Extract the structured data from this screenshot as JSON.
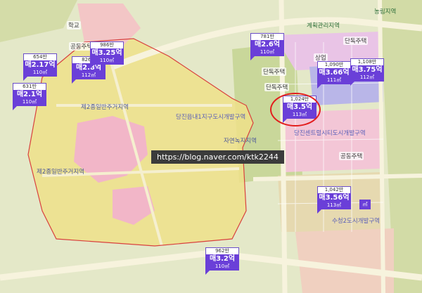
{
  "map": {
    "watermark": "https://blog.naver.com/ktk2244",
    "colors": {
      "residential_zone": "#eee08a",
      "boundary": "#d9413e",
      "road": "#f7f3dd",
      "green": "#cfd99c",
      "pin": "#6a3fd8",
      "highlight": "#e31d1d"
    },
    "labels": {
      "school": "학교",
      "apt_left": "공동주택",
      "zone_2_upper": "제2종일반주거지역",
      "zone_2_lower": "제2종일반주거지역",
      "dev_district": "당진읍내1지구도시개발구역",
      "natural_green": "자연녹지지역",
      "danbuk_house": "단독주택",
      "sangup": "상업",
      "gyehoek": "계획관리지역",
      "danbuk_house_right": "단독주택",
      "danbuk_house_mid": "단독주택",
      "nonglim": "농림지역",
      "city_dev": "당진센트럴시티도시개발구역",
      "apt_right": "공동주택",
      "sujeong": "수청2도시개발구역"
    },
    "pins": [
      {
        "id": "pin-654",
        "units": "654만",
        "price": "매2.17억",
        "area": "110㎡"
      },
      {
        "id": "pin-631",
        "units": "631만",
        "price": "매2.1억",
        "area": "110㎡"
      },
      {
        "id": "pin-826",
        "units": "826만",
        "price": "매2.8억",
        "area": "112㎡"
      },
      {
        "id": "pin-986",
        "units": "986만",
        "price": "매3.25억",
        "area": "110㎡"
      },
      {
        "id": "pin-781",
        "units": "781만",
        "price": "매2.6억",
        "area": "110㎡"
      },
      {
        "id": "pin-1090",
        "units": "1,090만",
        "price": "매3.66억",
        "area": "111㎡"
      },
      {
        "id": "pin-1108",
        "units": "1,108만",
        "price": "매3.75억",
        "area": "112㎡"
      },
      {
        "id": "pin-1024",
        "units": "1,024만",
        "price": "매3.5억",
        "area": "113㎡"
      },
      {
        "id": "pin-1042",
        "units": "1,042만",
        "price": "매3.56억",
        "area": "113㎡"
      },
      {
        "id": "pin-962",
        "units": "962만",
        "price": "매3.2억",
        "area": "110㎡"
      }
    ],
    "mini_pin": "㎡"
  }
}
